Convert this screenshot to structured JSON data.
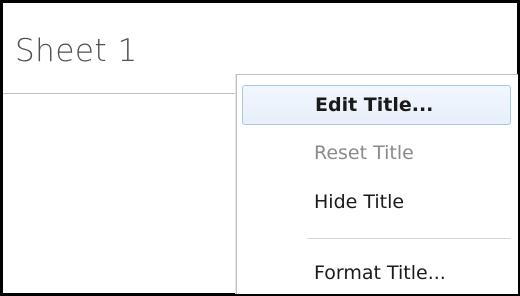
{
  "sheet": {
    "title": "Sheet 1"
  },
  "context_menu": {
    "items": [
      {
        "label": "Edit Title...",
        "state": "highlighted",
        "bold": true
      },
      {
        "label": "Reset Title",
        "state": "disabled"
      },
      {
        "label": "Hide Title",
        "state": "enabled"
      },
      {
        "label": "Format Title...",
        "state": "enabled"
      }
    ]
  },
  "colors": {
    "highlight_border": "#a8c8ea",
    "highlight_fill": "#e6effa",
    "disabled_text": "#8a8a8a",
    "title_text": "#505050"
  }
}
